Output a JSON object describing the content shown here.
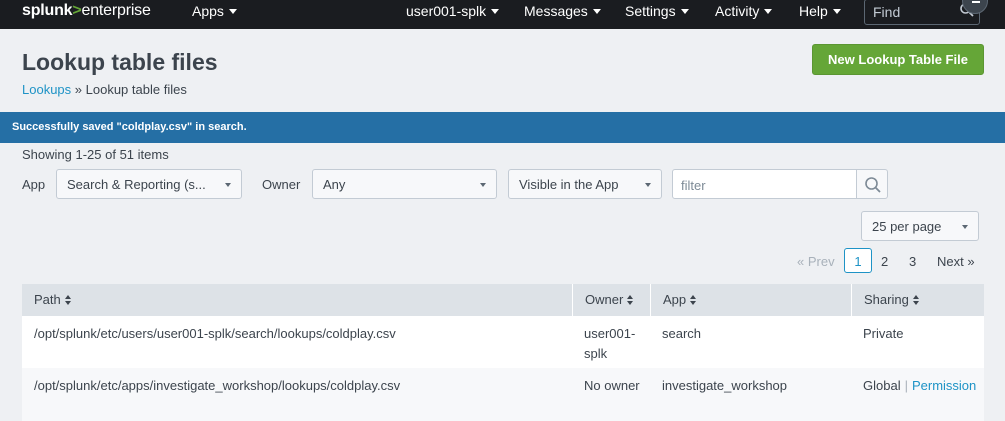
{
  "navbar": {
    "logo": {
      "brand": "splunk",
      "gt": ">",
      "product": "enterprise"
    },
    "apps_label": "Apps",
    "user_label": "user001-splk",
    "messages_label": "Messages",
    "settings_label": "Settings",
    "activity_label": "Activity",
    "help_label": "Help",
    "find_placeholder": "Find"
  },
  "header": {
    "title": "Lookup table files",
    "breadcrumb": {
      "parent": "Lookups",
      "separator": "»",
      "current": "Lookup table files"
    },
    "new_button_label": "New Lookup Table File"
  },
  "banner": {
    "message": "Successfully saved \"coldplay.csv\" in search."
  },
  "showing_text": "Showing 1-25 of 51 items",
  "filters": {
    "app_label": "App",
    "app_value": "Search & Reporting (s...",
    "owner_label": "Owner",
    "owner_value": "Any",
    "visibility_value": "Visible in the App",
    "filter_placeholder": "filter"
  },
  "pagination": {
    "per_page_value": "25 per page",
    "prev_label": "« Prev",
    "pages": [
      "1",
      "2",
      "3"
    ],
    "current_page": "1",
    "next_label": "Next »"
  },
  "table": {
    "columns": [
      "Path",
      "Owner",
      "App",
      "Sharing"
    ],
    "rows": [
      {
        "path": "/opt/splunk/etc/users/user001-splk/search/lookups/coldplay.csv",
        "owner": "user001-splk",
        "app": "search",
        "sharing": "Private",
        "permission_link": ""
      },
      {
        "path": "/opt/splunk/etc/apps/investigate_workshop/lookups/coldplay.csv",
        "owner": "No owner",
        "app": "investigate_workshop",
        "sharing": "Global",
        "sharing_separator": "|",
        "permission_link": "Permission"
      }
    ]
  },
  "colors": {
    "navbar_bg": "#1a1c20",
    "accent_green": "#65a637",
    "banner_blue": "#256fa5",
    "link_blue": "#1e93c6"
  },
  "icons": [
    "search-icon",
    "caret-down-icon",
    "sort-icon"
  ]
}
